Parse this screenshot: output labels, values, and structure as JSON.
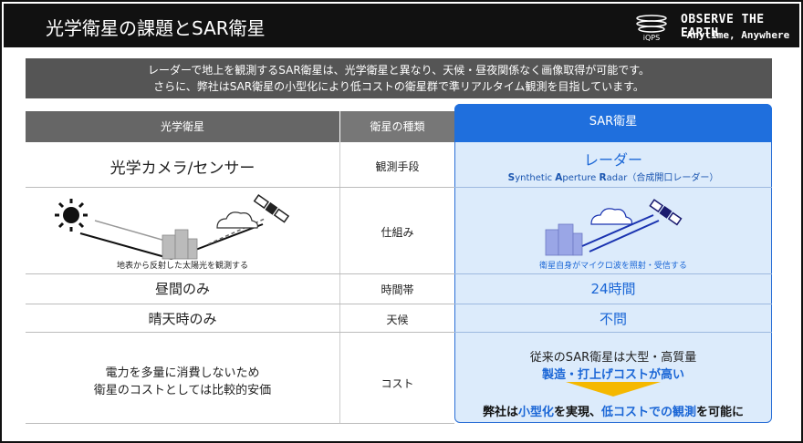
{
  "header": {
    "title": "光学衛星の課題とSAR衛星",
    "brand_main": "OBSERVE THE EARTH",
    "brand_sub": "-Anytime, Anywhere",
    "logo_text": "iQPS"
  },
  "banner": {
    "line1": "レーダーで地上を観測するSAR衛星は、光学衛星と異なり、天候・昼夜関係なく画像取得が可能です。",
    "line2": "さらに、弊社はSAR衛星の小型化により低コストの衛星群で準リアルタイム観測を目指しています。"
  },
  "table": {
    "headers": {
      "optical": "光学衛星",
      "category": "衛星の種類",
      "sar": "SAR衛星"
    },
    "rows": {
      "method": {
        "label": "観測手段",
        "optical": "光学カメラ/センサー",
        "sar": "レーダー",
        "sar_sub": {
          "s": "S",
          "ynthetic": "ynthetic ",
          "a": "A",
          "perture": "perture ",
          "r": "R",
          "adar": "adar",
          "note": "（合成開口レーダー）"
        }
      },
      "mechanism": {
        "label": "仕組み",
        "optical_caption": "地表から反射した太陽光を観測する",
        "sar_caption": "衛星自身がマイクロ波を照射・受信する"
      },
      "time": {
        "label": "時間帯",
        "optical": "昼間のみ",
        "sar": "24時間"
      },
      "weather": {
        "label": "天候",
        "optical": "晴天時のみ",
        "sar": "不問"
      },
      "cost": {
        "label": "コスト",
        "optical_line1": "電力を多量に消費しないため",
        "optical_line2": "衛星のコストとしては比較的安価",
        "sar_line1": "従来のSAR衛星は大型・高質量",
        "sar_line2": "製造・打上げコストが高い",
        "sar_line3_a": "弊社は",
        "sar_line3_b": "小型化",
        "sar_line3_c": "を実現、",
        "sar_line3_d": "低コストでの観測",
        "sar_line3_e": "を可能に"
      }
    }
  },
  "colors": {
    "accent": "#1f6fdd",
    "sar_bg": "#dcebfb",
    "header_bg": "#111111",
    "banner_bg": "#555555",
    "arrow": "#f5b800"
  },
  "icons": [
    "sun-icon",
    "cloud-icon",
    "satellite-icon",
    "building-icon"
  ]
}
